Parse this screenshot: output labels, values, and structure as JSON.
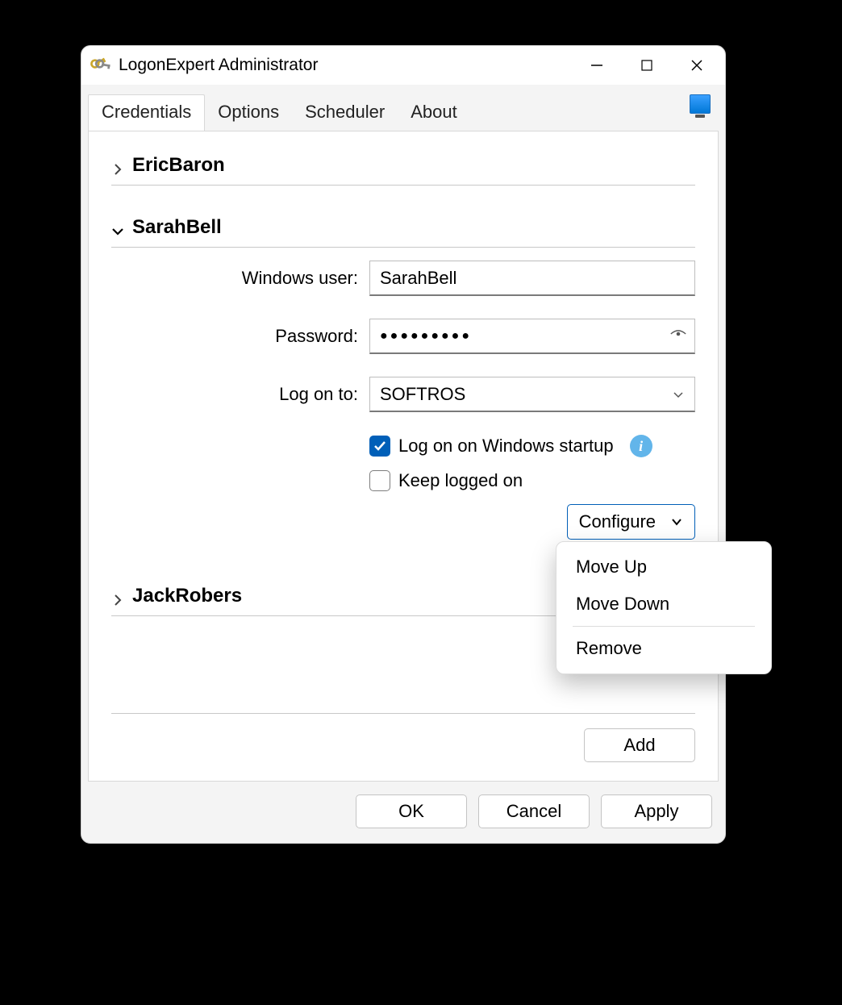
{
  "window": {
    "title": "LogonExpert Administrator"
  },
  "tabs": [
    "Credentials",
    "Options",
    "Scheduler",
    "About"
  ],
  "credentials": [
    {
      "name": "EricBaron",
      "expanded": false
    },
    {
      "name": "SarahBell",
      "expanded": true
    },
    {
      "name": "JackRobers",
      "expanded": false
    }
  ],
  "form": {
    "labels": {
      "user": "Windows user:",
      "password": "Password:",
      "logon": "Log on to:"
    },
    "user": "SarahBell",
    "password_mask": "●●●●●●●●●",
    "logon_to": "SOFTROS",
    "cb_startup": "Log on on Windows startup",
    "cb_startup_checked": true,
    "cb_keep": "Keep logged on",
    "cb_keep_checked": false
  },
  "configure": {
    "label": "Configure",
    "menu": [
      "Move Up",
      "Move Down",
      "Remove"
    ]
  },
  "buttons": {
    "add": "Add",
    "ok": "OK",
    "cancel": "Cancel",
    "apply": "Apply"
  }
}
